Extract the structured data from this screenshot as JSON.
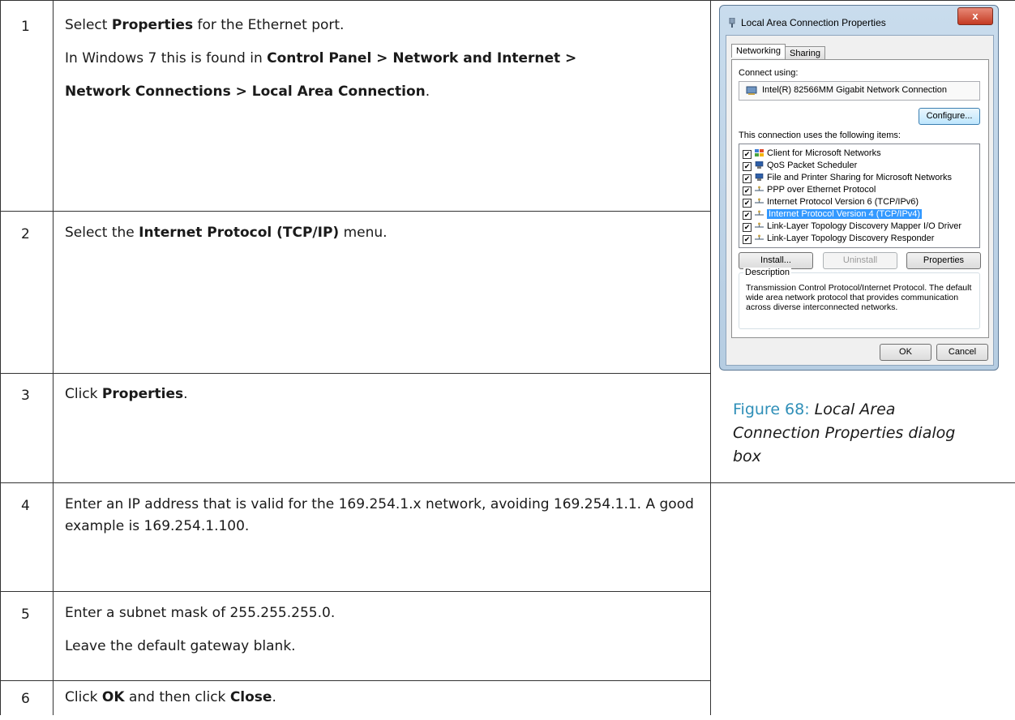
{
  "steps": [
    {
      "num": "1",
      "lines": [
        [
          {
            "t": "Select ",
            "b": false
          },
          {
            "t": "Properties",
            "b": true
          },
          {
            "t": " for the Ethernet port.",
            "b": false
          }
        ],
        [
          {
            "t": "In Windows 7 this is found in ",
            "b": false
          },
          {
            "t": "Control Panel > Network and Internet >",
            "b": true
          }
        ],
        [
          {
            "t": "Network Connections > Local Area Connection",
            "b": true
          },
          {
            "t": ".",
            "b": false
          }
        ]
      ]
    },
    {
      "num": "2",
      "lines": [
        [
          {
            "t": "Select the ",
            "b": false
          },
          {
            "t": "Internet Protocol (TCP/IP)",
            "b": true
          },
          {
            "t": " menu.",
            "b": false
          }
        ]
      ]
    },
    {
      "num": "3",
      "lines": [
        [
          {
            "t": "Click ",
            "b": false
          },
          {
            "t": "Properties",
            "b": true
          },
          {
            "t": ".",
            "b": false
          }
        ]
      ]
    },
    {
      "num": "4",
      "lines": [
        [
          {
            "t": "Enter an IP address that is valid for the 169.254.1.x network, avoiding 169.254.1.1.  A good example is 169.254.1.100.",
            "b": false
          }
        ]
      ]
    },
    {
      "num": "5",
      "lines": [
        [
          {
            "t": "Enter a subnet mask of 255.255.255.0.",
            "b": false
          }
        ],
        [
          {
            "t": "Leave the default gateway blank.",
            "b": false
          }
        ]
      ]
    },
    {
      "num": "6",
      "lines": [
        [
          {
            "t": "Click ",
            "b": false
          },
          {
            "t": "OK",
            "b": true
          },
          {
            "t": " and then click ",
            "b": false
          },
          {
            "t": "Close",
            "b": true
          },
          {
            "t": ".",
            "b": false
          }
        ]
      ]
    }
  ],
  "figure": {
    "label": "Figure 68: ",
    "title": "Local Area Connection Properties dialog box"
  },
  "dialog": {
    "title": "Local Area Connection Properties",
    "close_glyph": "x",
    "tabs": [
      "Networking",
      "Sharing"
    ],
    "connect_using_label": "Connect using:",
    "adapter": "Intel(R) 82566MM Gigabit Network Connection",
    "configure_button": "Configure...",
    "items_label": "This connection uses the following items:",
    "items": [
      {
        "label": "Client for Microsoft Networks",
        "checked": true,
        "selected": false,
        "icon": "network-client-icon"
      },
      {
        "label": "QoS Packet Scheduler",
        "checked": true,
        "selected": false,
        "icon": "service-icon"
      },
      {
        "label": "File and Printer Sharing for Microsoft Networks",
        "checked": true,
        "selected": false,
        "icon": "service-icon"
      },
      {
        "label": "PPP over Ethernet Protocol",
        "checked": true,
        "selected": false,
        "icon": "protocol-icon"
      },
      {
        "label": "Internet Protocol Version 6 (TCP/IPv6)",
        "checked": true,
        "selected": false,
        "icon": "protocol-icon"
      },
      {
        "label": "Internet Protocol Version 4 (TCP/IPv4)",
        "checked": true,
        "selected": true,
        "icon": "protocol-icon"
      },
      {
        "label": "Link-Layer Topology Discovery Mapper I/O Driver",
        "checked": true,
        "selected": false,
        "icon": "protocol-icon"
      },
      {
        "label": "Link-Layer Topology Discovery Responder",
        "checked": true,
        "selected": false,
        "icon": "protocol-icon"
      }
    ],
    "install_button": "Install...",
    "uninstall_button": "Uninstall",
    "properties_button": "Properties",
    "description_label": "Description",
    "description_text": "Transmission Control Protocol/Internet Protocol. The default wide area network protocol that provides communication across diverse interconnected networks.",
    "ok_button": "OK",
    "cancel_button": "Cancel"
  }
}
